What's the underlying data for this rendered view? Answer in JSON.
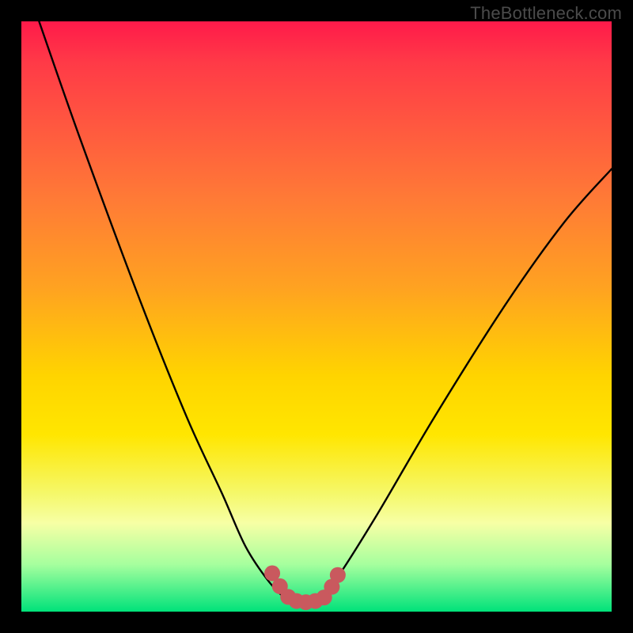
{
  "watermark": "TheBottleneck.com",
  "chart_data": {
    "type": "line",
    "title": "",
    "xlabel": "",
    "ylabel": "",
    "xlim": [
      0,
      100
    ],
    "ylim": [
      0,
      100
    ],
    "series": [
      {
        "name": "bottleneck-curve",
        "x": [
          3,
          10,
          20,
          28,
          34,
          38,
          42,
          45,
          47,
          50,
          53,
          60,
          70,
          82,
          92,
          100
        ],
        "y": [
          100,
          80,
          53,
          33,
          20,
          11,
          5,
          2,
          1,
          2,
          5,
          16,
          33,
          52,
          66,
          75
        ]
      }
    ],
    "markers": {
      "name": "highlight-dots",
      "color": "#c9595e",
      "points": [
        {
          "x": 42.5,
          "y": 6.5
        },
        {
          "x": 43.8,
          "y": 4.3
        },
        {
          "x": 45.2,
          "y": 2.5
        },
        {
          "x": 46.6,
          "y": 1.8
        },
        {
          "x": 48.2,
          "y": 1.6
        },
        {
          "x": 49.8,
          "y": 1.8
        },
        {
          "x": 51.3,
          "y": 2.4
        },
        {
          "x": 52.6,
          "y": 4.2
        },
        {
          "x": 53.6,
          "y": 6.2
        }
      ]
    },
    "gradient_stops": [
      {
        "pos": 0,
        "color": "#ff1a4a"
      },
      {
        "pos": 50,
        "color": "#ffd400"
      },
      {
        "pos": 85,
        "color": "#f7ffa5"
      },
      {
        "pos": 100,
        "color": "#00e27a"
      }
    ]
  }
}
